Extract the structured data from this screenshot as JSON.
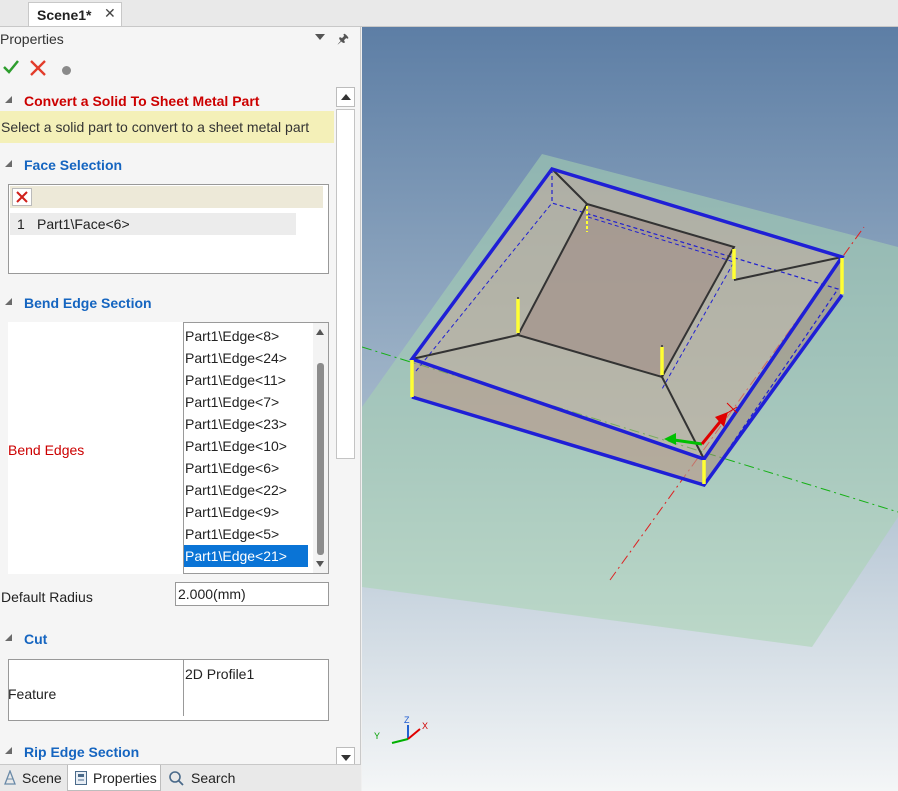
{
  "document_tab": {
    "title": "Scene1*"
  },
  "panel": {
    "title": "Properties",
    "convert_section": {
      "title": "Convert a Solid To Sheet Metal Part",
      "hint": "Select a solid part to convert to a sheet metal part"
    },
    "face_section": {
      "title": "Face Selection",
      "rows": [
        {
          "index": "1",
          "value": "Part1\\Face<6>"
        }
      ]
    },
    "bend_section": {
      "title": "Bend Edge Section",
      "label": "Bend Edges",
      "edges": [
        "Part1\\Edge<8>",
        "Part1\\Edge<24>",
        "Part1\\Edge<11>",
        "Part1\\Edge<7>",
        "Part1\\Edge<23>",
        "Part1\\Edge<10>",
        "Part1\\Edge<6>",
        "Part1\\Edge<22>",
        "Part1\\Edge<9>",
        "Part1\\Edge<5>",
        "Part1\\Edge<21>"
      ],
      "selected_edge": "Part1\\Edge<21>"
    },
    "default_radius": {
      "label": "Default Radius",
      "value": "2.000(mm)"
    },
    "cut_section": {
      "title": "Cut",
      "feature_label": "Feature",
      "feature_value": "2D Profile1"
    },
    "rip_section": {
      "title": "Rip Edge Section"
    }
  },
  "bottom_tabs": [
    {
      "label": "Scene",
      "active": false
    },
    {
      "label": "Properties",
      "active": true
    },
    {
      "label": "Search",
      "active": false
    }
  ],
  "triad": {
    "x": "X",
    "y": "Y",
    "z": "Z"
  },
  "colors": {
    "accent_blue": "#1565c0",
    "accent_red": "#cc0000",
    "selection": "#0a74d6",
    "hint_bg": "#f4f0b8",
    "edge_blue": "#1f1fd6",
    "edge_yellow": "#ffff33"
  },
  "icons": {
    "ok": "checkmark-icon",
    "cancel": "x-icon",
    "pin": "pin-icon",
    "delete": "delete-icon",
    "scene": "scene-icon",
    "properties": "properties-icon",
    "search": "search-icon"
  }
}
